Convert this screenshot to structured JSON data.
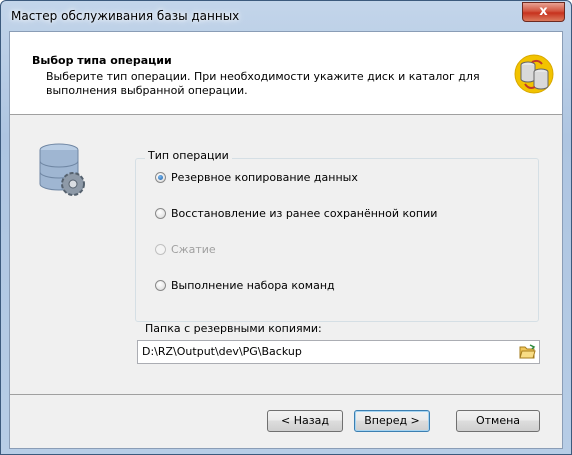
{
  "window": {
    "title": "Мастер обслуживания базы данных",
    "close_glyph": "x"
  },
  "header": {
    "title": "Выбор типа операции",
    "description": "Выберите тип операции. При необходимости  укажите диск и каталог для выполнения выбранной операции.",
    "icon": "database-swap-icon"
  },
  "main_icon": "database-gear-icon",
  "operation_group": {
    "label": "Тип операции",
    "options": [
      {
        "label": "Резервное копирование данных",
        "checked": true,
        "enabled": true
      },
      {
        "label": "Восстановление из ранее сохранённой копии",
        "checked": false,
        "enabled": true
      },
      {
        "label": "Сжатие",
        "checked": false,
        "enabled": false
      },
      {
        "label": "Выполнение набора команд",
        "checked": false,
        "enabled": true
      }
    ]
  },
  "folder": {
    "label": "Папка с резервными копиями:",
    "value": "D:\\RZ\\Output\\dev\\PG\\Backup",
    "browse_icon": "folder-open-icon"
  },
  "buttons": {
    "back": "< Назад",
    "next": "Вперед >",
    "cancel": "Отмена"
  },
  "colors": {
    "accent": "#3c7fb1",
    "close": "#c7321e"
  }
}
